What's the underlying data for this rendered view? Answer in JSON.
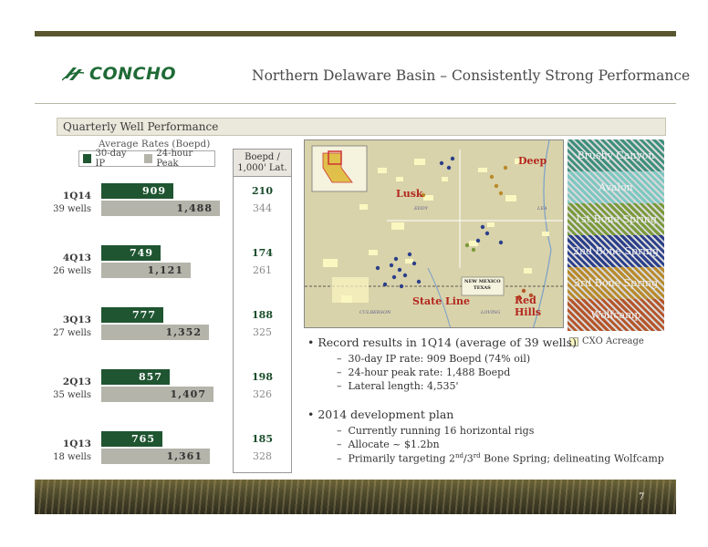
{
  "header": {
    "logo_text": "CONCHO",
    "title": "Northern Delaware Basin – Consistently Strong Performance"
  },
  "section": {
    "title": "Quarterly Well Performance"
  },
  "chart_data": {
    "type": "bar",
    "title": "Average Rates (Boepd)",
    "categories": [
      "1Q14\n39 wells",
      "4Q13\n26 wells",
      "3Q13\n27 wells",
      "2Q13\n35 wells",
      "1Q13\n18 wells"
    ],
    "series": [
      {
        "name": "30-day IP",
        "values": [
          909,
          749,
          777,
          857,
          765
        ],
        "color": "#1f5531"
      },
      {
        "name": "24-hour Peak",
        "values": [
          1488,
          1121,
          1352,
          1407,
          1361
        ],
        "color": "#b4b4aa"
      }
    ],
    "boepd_per_1000_lat": {
      "header": "Boepd / 1,000' Lat.",
      "ip": [
        210,
        174,
        188,
        198,
        185
      ],
      "peak": [
        344,
        261,
        325,
        326,
        328
      ]
    }
  },
  "quarters": [
    {
      "q": "1Q14",
      "wells": "39 wells",
      "ip": "909",
      "pk": "1,488",
      "bip": "210",
      "bpk": "344"
    },
    {
      "q": "4Q13",
      "wells": "26 wells",
      "ip": "749",
      "pk": "1,121",
      "bip": "174",
      "bpk": "261"
    },
    {
      "q": "3Q13",
      "wells": "27 wells",
      "ip": "777",
      "pk": "1,352",
      "bip": "188",
      "bpk": "325"
    },
    {
      "q": "2Q13",
      "wells": "35 wells",
      "ip": "857",
      "pk": "1,407",
      "bip": "198",
      "bpk": "326"
    },
    {
      "q": "1Q13",
      "wells": "18 wells",
      "ip": "765",
      "pk": "1,361",
      "bip": "185",
      "bpk": "328"
    }
  ],
  "legend": {
    "ip": "30-day IP",
    "pk": "24-hour Peak"
  },
  "map": {
    "labels": {
      "lusk": "Lusk",
      "deep": "Deep",
      "state_line": "State Line",
      "red_hills": "Red Hills",
      "eddy": "EDDY",
      "lea": "LEA",
      "culberson": "CULBERSON",
      "loving": "LOVING",
      "nm": "NEW MEXICO",
      "tx": "TEXAS"
    }
  },
  "strat_legend": [
    {
      "label": "Brushy Canyon",
      "color": "#3f8f7d"
    },
    {
      "label": "Avalon",
      "color": "#7dc7c2"
    },
    {
      "label": "1st Bone Spring",
      "color": "#7a9a3a"
    },
    {
      "label": "2nd Bone Spring",
      "color": "#2b3f8a"
    },
    {
      "label": "3rd Bone Spring",
      "color": "#b88a2a"
    },
    {
      "label": "Wolfcamp",
      "color": "#b5552a"
    }
  ],
  "cxo_acreage": "CXO Acreage",
  "bullets": {
    "b1": "Record results in 1Q14 (average of 39 wells)",
    "b1_s1": "30-day IP rate: 909 Boepd (74% oil)",
    "b1_s2": "24-hour peak rate: 1,488 Boepd",
    "b1_s3": "Lateral length: 4,535'",
    "b2": "2014 development plan",
    "b2_s1": "Currently running 16 horizontal rigs",
    "b2_s2": "Allocate ~ $1.2bn",
    "b2_s3_a": "Primarily targeting 2",
    "b2_s3_sup1": "nd",
    "b2_s3_b": "/3",
    "b2_s3_sup2": "rd",
    "b2_s3_c": " Bone Spring; delineating Wolfcamp"
  },
  "page_number": "7"
}
